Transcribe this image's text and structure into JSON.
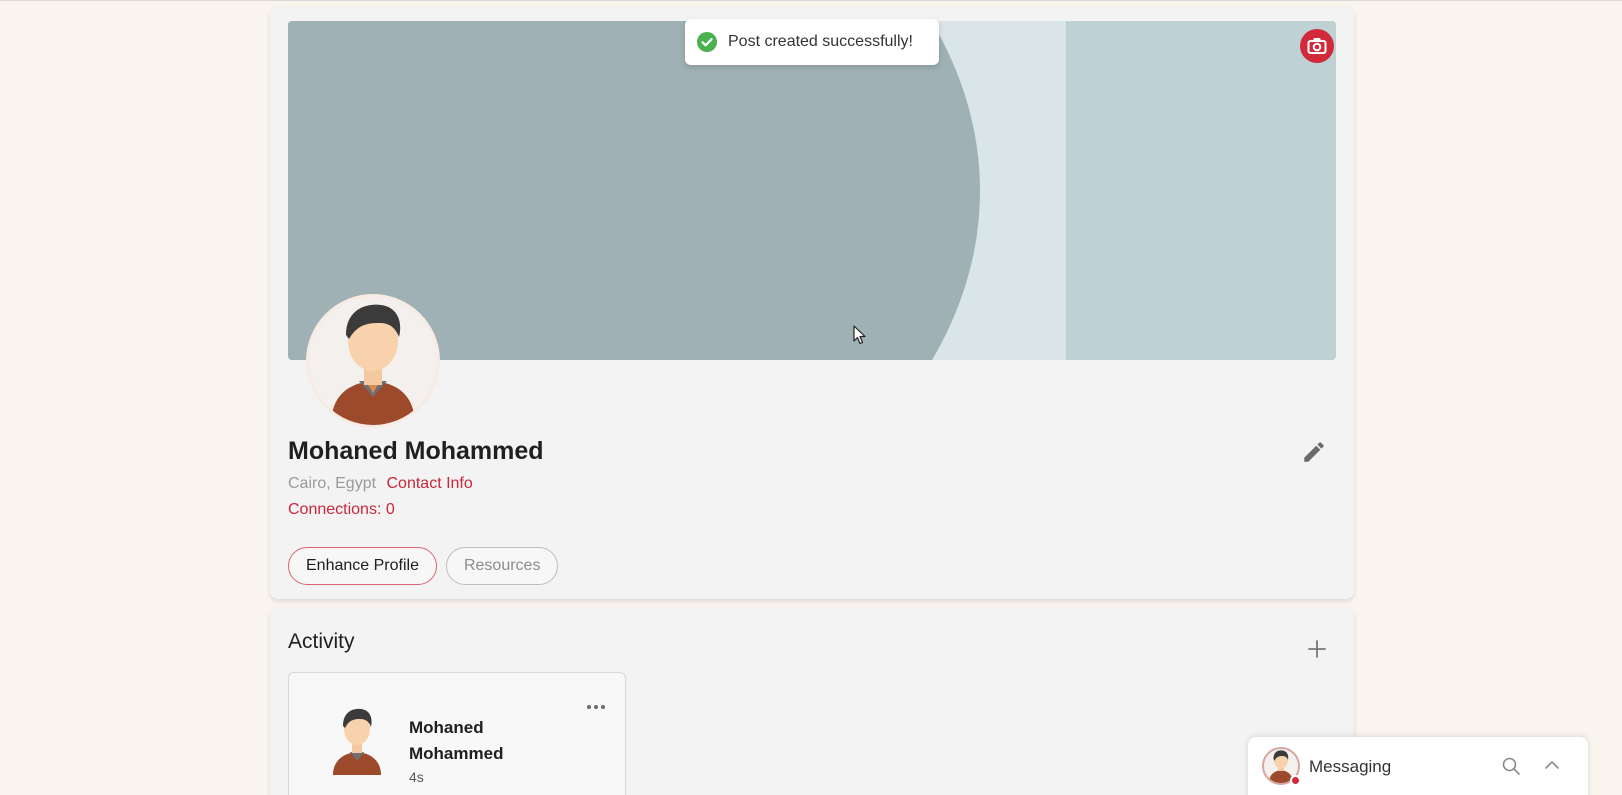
{
  "profile": {
    "name": "Mohaned Mohammed",
    "location": "Cairo, Egypt",
    "contact_info_label": "Contact Info",
    "connections_label": "Connections: 0",
    "buttons": {
      "enhance": "Enhance Profile",
      "resources": "Resources"
    }
  },
  "toast": {
    "message": "Post created successfully!",
    "icon": "check-circle-icon",
    "color": "#4caf50"
  },
  "activity": {
    "title": "Activity",
    "posts": [
      {
        "author": "Mohaned Mohammed",
        "time": "4s"
      }
    ]
  },
  "messaging": {
    "title": "Messaging"
  },
  "colors": {
    "accent": "#c8283a",
    "background": "#f9f4ee",
    "card": "#f3f3f3"
  },
  "icons": {
    "camera": "camera-icon",
    "edit": "pencil-icon",
    "add": "plus-icon",
    "more": "more-horizontal-icon",
    "search": "search-icon",
    "chevron": "chevron-up-icon"
  }
}
